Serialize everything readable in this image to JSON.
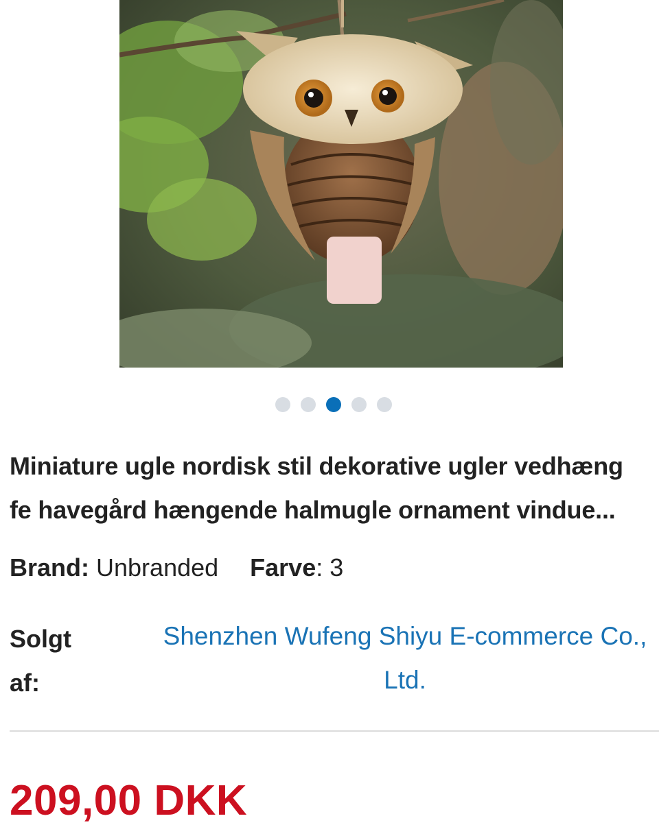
{
  "product": {
    "image_alt": "Owl ornament made of pine cone and straw hanging outdoors",
    "carousel": {
      "total": 5,
      "active_index": 2
    },
    "title_line1": "Miniature ugle nordisk stil dekorative ugler vedhæng",
    "title_line2": "fe havegård hængende halmugle ornament vindue...",
    "brand_label": "Brand:",
    "brand_value": "Unbranded",
    "color_label": "Farve",
    "color_value": ": 3",
    "seller_label_line1": "Solgt",
    "seller_label_line2": "af:",
    "seller_name_line1": "Shenzhen Wufeng Shiyu E-commerce Co.,",
    "seller_name_line2": "Ltd.",
    "price": "209,00 DKK"
  },
  "colors": {
    "price": "#cc1020",
    "link": "#1a73b5",
    "dot_active": "#0a6fb8",
    "dot_inactive": "#d8dde3"
  }
}
